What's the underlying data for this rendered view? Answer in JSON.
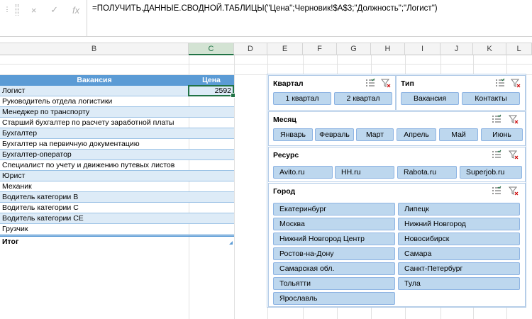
{
  "formula_bar": {
    "cancel_icon": "×",
    "enter_icon": "✓",
    "fx_label": "fx",
    "formula": "=ПОЛУЧИТЬ.ДАННЫЕ.СВОДНОЙ.ТАБЛИЦЫ(\"Цена\";Черновик!$A$3;\"Должность\";\"Логист\")"
  },
  "columns": [
    "B",
    "C",
    "D",
    "E",
    "F",
    "G",
    "H",
    "I",
    "J",
    "K",
    "L"
  ],
  "pivot": {
    "header_b": "Вакансия",
    "header_c": "Цена",
    "rows": [
      {
        "label": "Логист",
        "value": "2592"
      },
      {
        "label": "Руководитель отдела логистики",
        "value": ""
      },
      {
        "label": "Менеджер по транспорту",
        "value": ""
      },
      {
        "label": "Старший бухгалтер по расчету заработной платы",
        "value": ""
      },
      {
        "label": "Бухгалтер",
        "value": ""
      },
      {
        "label": "Бухгалтер на первичную документацию",
        "value": ""
      },
      {
        "label": "Бухгалтер-оператор",
        "value": ""
      },
      {
        "label": "Специалист по учету и движению путевых листов",
        "value": ""
      },
      {
        "label": "Юрист",
        "value": ""
      },
      {
        "label": "Механик",
        "value": ""
      },
      {
        "label": "Водитель категории B",
        "value": ""
      },
      {
        "label": "Водитель категории C",
        "value": ""
      },
      {
        "label": "Водитель категории CE",
        "value": ""
      },
      {
        "label": "Грузчик",
        "value": ""
      }
    ],
    "total_label": "Итог"
  },
  "slicers": {
    "kvartal": {
      "title": "Квартал",
      "items": [
        "1 квартал",
        "2 квартал"
      ]
    },
    "tip": {
      "title": "Тип",
      "items": [
        "Вакансия",
        "Контакты"
      ]
    },
    "mesyac": {
      "title": "Месяц",
      "items": [
        "Январь",
        "Февраль",
        "Март",
        "Апрель",
        "Май",
        "Июнь"
      ]
    },
    "resurs": {
      "title": "Ресурс",
      "items": [
        "Avito.ru",
        "HH.ru",
        "Rabota.ru",
        "Superjob.ru"
      ]
    },
    "gorod": {
      "title": "Город",
      "items": [
        "Екатеринбург",
        "Липецк",
        "Москва",
        "Нижний Новгород",
        "Нижний Новгород Центр",
        "Новосибирск",
        "Ростов-на-Дону",
        "Самара",
        "Самарская обл.",
        "Санкт-Петербург",
        "Тольятти",
        "Тула",
        "Ярославль"
      ]
    }
  },
  "icons": {
    "multiselect": "multi-select-icon",
    "clear_filter": "clear-filter-icon"
  },
  "colors": {
    "pivot_header": "#5b9bd5",
    "pivot_band": "#ddebf7",
    "slicer_button": "#bdd7ee",
    "excel_green": "#217346"
  }
}
